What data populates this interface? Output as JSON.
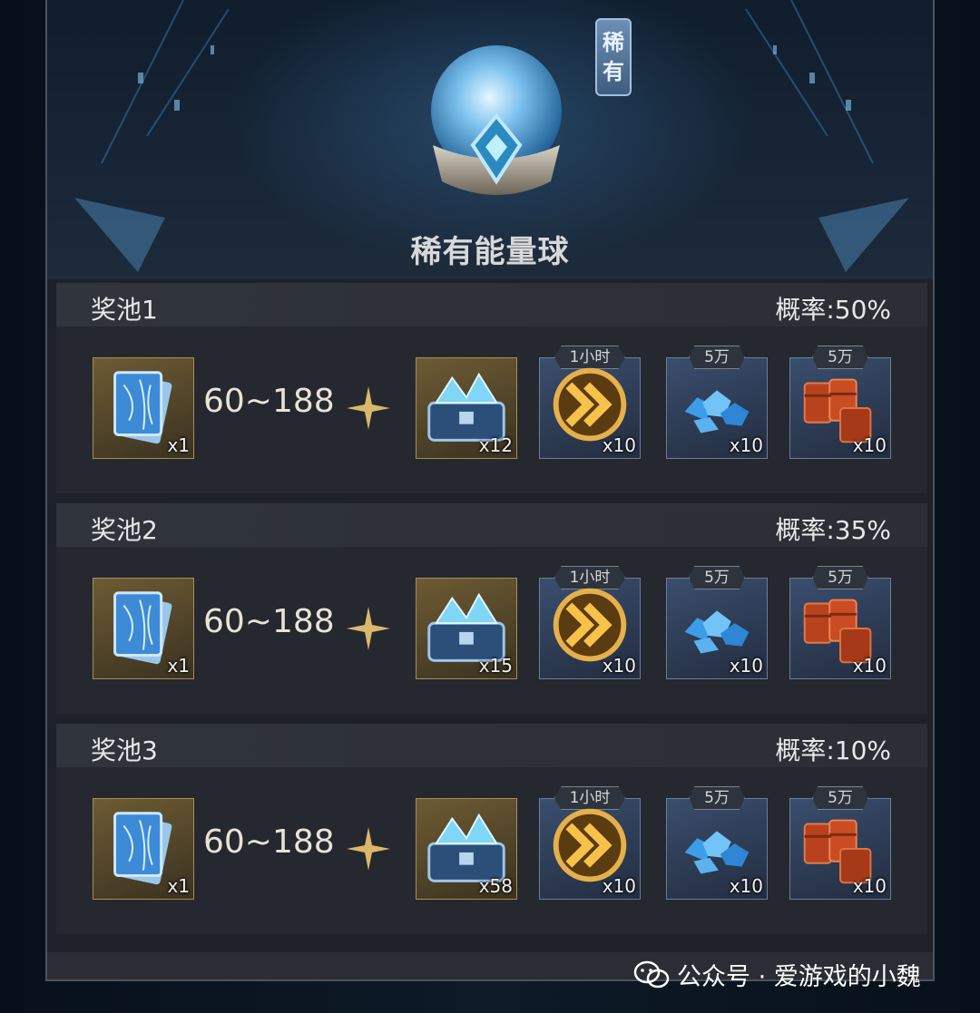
{
  "header": {
    "rarity_tag": [
      "稀",
      "有"
    ],
    "title": "稀有能量球"
  },
  "pools": [
    {
      "name": "奖池1",
      "rate": "概率:50%",
      "base_qty": "x1",
      "range": "60~188",
      "items": [
        {
          "icon": "crystal-chest-icon",
          "qty": "x12",
          "badge": ""
        },
        {
          "icon": "speedup-icon",
          "qty": "x10",
          "badge": "1小时"
        },
        {
          "icon": "crystal-ore-icon",
          "qty": "x10",
          "badge": "5万"
        },
        {
          "icon": "oil-barrel-icon",
          "qty": "x10",
          "badge": "5万"
        }
      ]
    },
    {
      "name": "奖池2",
      "rate": "概率:35%",
      "base_qty": "x1",
      "range": "60~188",
      "items": [
        {
          "icon": "crystal-chest-icon",
          "qty": "x15",
          "badge": ""
        },
        {
          "icon": "speedup-icon",
          "qty": "x10",
          "badge": "1小时"
        },
        {
          "icon": "crystal-ore-icon",
          "qty": "x10",
          "badge": "5万"
        },
        {
          "icon": "oil-barrel-icon",
          "qty": "x10",
          "badge": "5万"
        }
      ]
    },
    {
      "name": "奖池3",
      "rate": "概率:10%",
      "base_qty": "x1",
      "range": "60~188",
      "items": [
        {
          "icon": "crystal-chest-icon",
          "qty": "x58",
          "badge": ""
        },
        {
          "icon": "speedup-icon",
          "qty": "x10",
          "badge": "1小时"
        },
        {
          "icon": "crystal-ore-icon",
          "qty": "x10",
          "badge": "5万"
        },
        {
          "icon": "oil-barrel-icon",
          "qty": "x10",
          "badge": "5万"
        }
      ]
    }
  ],
  "watermark": "公众号 · 爱游戏的小魏",
  "colors": {
    "gold_slot": "#6e5b34",
    "blue_slot": "#3a4e6e",
    "accent_gold": "#d9b86a"
  }
}
